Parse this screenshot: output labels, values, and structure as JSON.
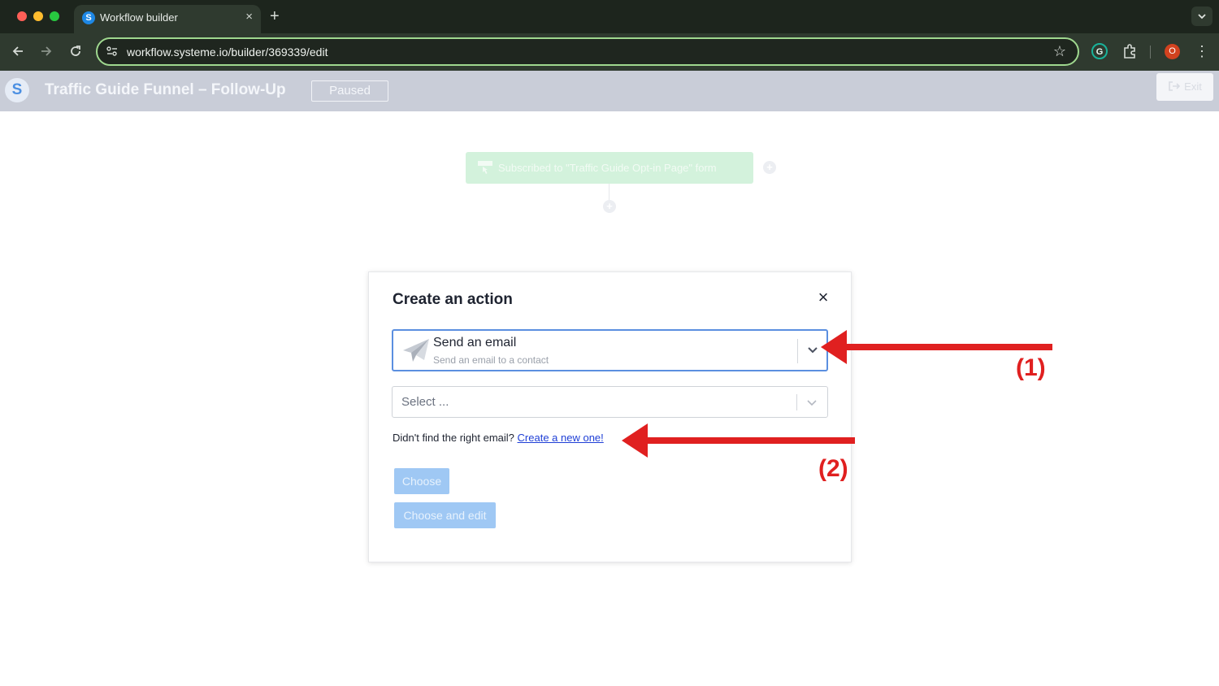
{
  "browser": {
    "tab_title": "Workflow builder",
    "tab_favicon_letter": "S",
    "tab_close": "×",
    "new_tab": "+",
    "url": "workflow.systeme.io/builder/369339/edit",
    "profile_initial": "O"
  },
  "app": {
    "logo_letter": "S",
    "title": "Traffic Guide Funnel – Follow-Up",
    "status": "Paused",
    "exit_label": "Exit"
  },
  "canvas": {
    "trigger_label": "Subscribed to \"Traffic Guide Opt-in Page\" form"
  },
  "modal": {
    "title": "Create an action",
    "close": "×",
    "action_select": {
      "label": "Send an email",
      "sublabel": "Send an email to a contact"
    },
    "email_select": {
      "placeholder": "Select ..."
    },
    "help_text": "Didn't find the right email?",
    "help_link": "Create a new one!",
    "choose_label": "Choose",
    "choose_edit_label": "Choose and edit"
  },
  "annotations": {
    "one": "(1)",
    "two": "(2)"
  },
  "colors": {
    "annotation_red": "#e02020",
    "focus_blue": "#5b8fe0",
    "link_blue": "#1f3fd6",
    "button_disabled": "#9fc8f4"
  }
}
